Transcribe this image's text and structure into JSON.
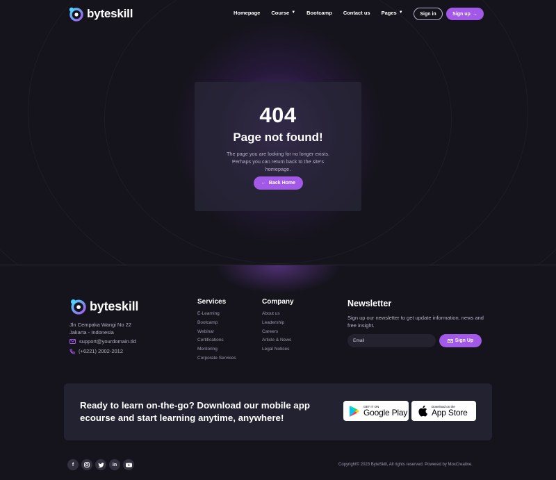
{
  "brand": {
    "name": "byteskill",
    "accent": "#a259e8",
    "gradient_top": "#4fd0ff",
    "gradient_bottom": "#a259e8"
  },
  "nav": {
    "items": [
      {
        "label": "Homepage",
        "dropdown": false
      },
      {
        "label": "Course",
        "dropdown": true
      },
      {
        "label": "Bootcamp",
        "dropdown": false
      },
      {
        "label": "Contact us",
        "dropdown": false
      },
      {
        "label": "Pages",
        "dropdown": true
      }
    ],
    "signin_label": "Sign in",
    "signup_label": "Sign up"
  },
  "error": {
    "code": "404",
    "title": "Page not found!",
    "description_line1": "The page you are looking for no longer exists.",
    "description_line2": "Perhaps you can return back to the site's",
    "description_line3": "homepage.",
    "button_label": "Back Home"
  },
  "footer": {
    "address_line1": "Jln Cempaka Wangi No 22",
    "address_line2": "Jakarta - Indonesia",
    "email": "support@yourdomain.tld",
    "phone": "(+6221) 2002-2012",
    "services": {
      "title": "Services",
      "links": [
        "E-Learning",
        "Bootcamp",
        "Webinar",
        "Certifications",
        "Mentoring",
        "Corporate Services"
      ]
    },
    "company": {
      "title": "Company",
      "links": [
        "About us",
        "Leadership",
        "Careers",
        "Article & News",
        "Legal Notices"
      ]
    },
    "newsletter": {
      "title": "Newsletter",
      "description": "Sign up our newsletter to get update information, news and free insight.",
      "placeholder": "Email",
      "button_label": "Sign Up"
    },
    "app_banner": {
      "text_line1": "Ready to learn on-the-go? Download our mobile app",
      "text_line2": "ecourse and start learning anytime, anywhere!",
      "google_small": "GET IT ON",
      "google_big": "Google Play",
      "apple_small": "Download on the",
      "apple_big": "App Store"
    },
    "socials": [
      "facebook-icon",
      "instagram-icon",
      "twitter-icon",
      "linkedin-icon",
      "youtube-icon"
    ],
    "copyright": "Copyright© 2023 ByteSkill, All rights reserved. Powered by MoxCreative."
  }
}
